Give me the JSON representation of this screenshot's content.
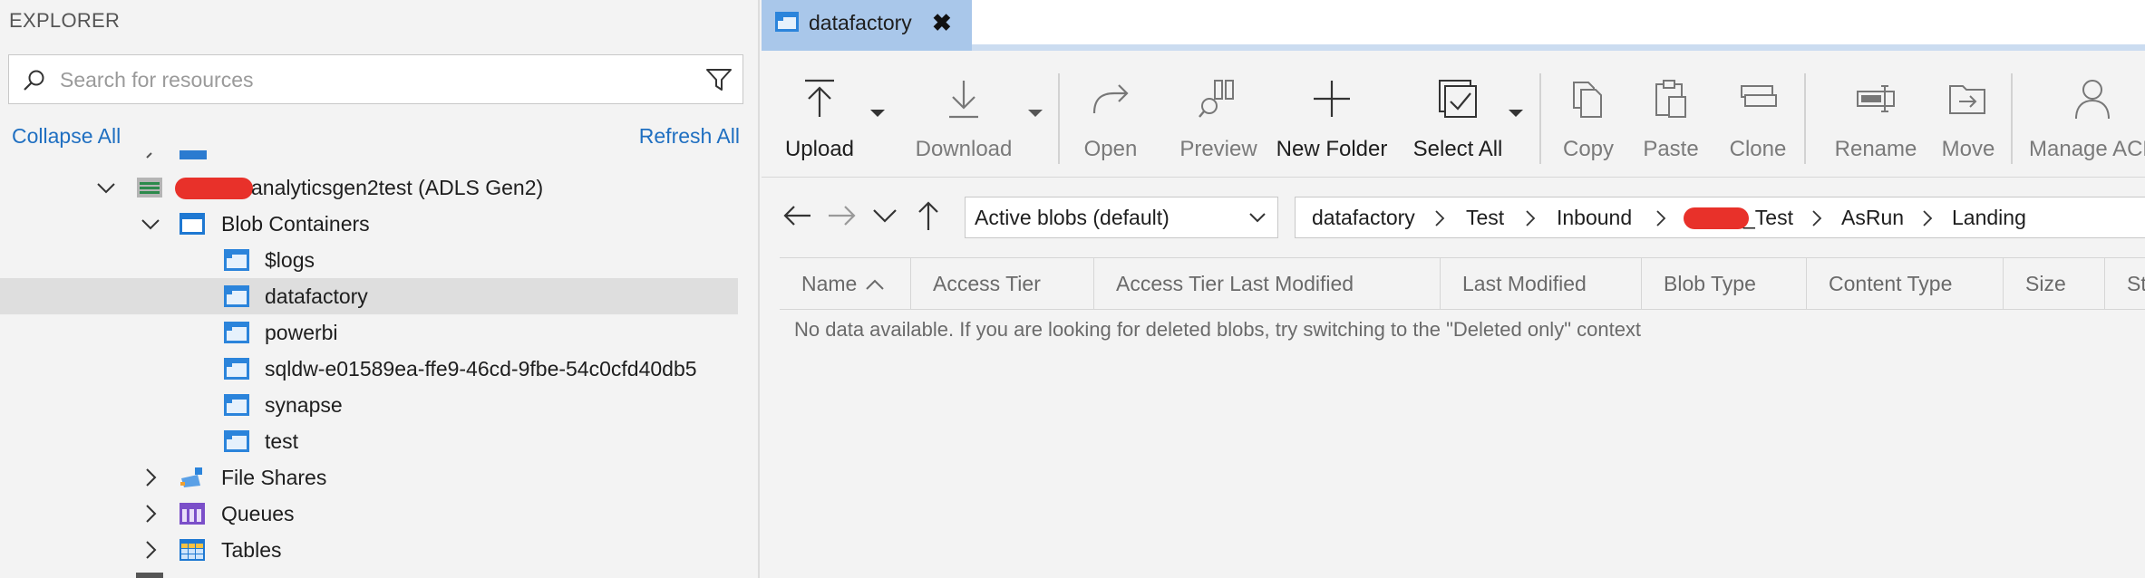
{
  "explorer": {
    "title": "EXPLORER",
    "search_placeholder": "Search for resources",
    "collapse_all": "Collapse All",
    "refresh_all": "Refresh All",
    "account_label": "analyticsgen2test (ADLS Gen2)",
    "blob_containers": "Blob Containers",
    "containers": [
      "$logs",
      "datafactory",
      "powerbi",
      "sqldw-e01589ea-ffe9-46cd-9fbe-54c0cfd40db5",
      "synapse",
      "test"
    ],
    "selected_container": "datafactory",
    "file_shares": "File Shares",
    "queues": "Queues",
    "tables": "Tables"
  },
  "tab": {
    "label": "datafactory",
    "close": "✖"
  },
  "toolbar": {
    "upload": "Upload",
    "download": "Download",
    "open": "Open",
    "preview": "Preview",
    "new_folder": "New Folder",
    "select_all": "Select All",
    "copy": "Copy",
    "paste": "Paste",
    "clone": "Clone",
    "rename": "Rename",
    "move": "Move",
    "manage_acl": "Manage ACL"
  },
  "nav": {
    "view_select": "Active blobs (default)",
    "breadcrumb": [
      "datafactory",
      "Test",
      "Inbound",
      "_Test",
      "AsRun",
      "Landing"
    ]
  },
  "table": {
    "columns": [
      "Name",
      "Access Tier",
      "Access Tier Last Modified",
      "Last Modified",
      "Blob Type",
      "Content Type",
      "Size",
      "St"
    ],
    "sort_indicator": "ascending",
    "empty_message": "No data available. If you are looking for deleted blobs, try switching to the \"Deleted only\" context"
  },
  "colors": {
    "accent_blue": "#1f6fc1",
    "tab_active": "#a9c7ea",
    "selected_row": "#dedede",
    "redaction": "#e8312a"
  }
}
